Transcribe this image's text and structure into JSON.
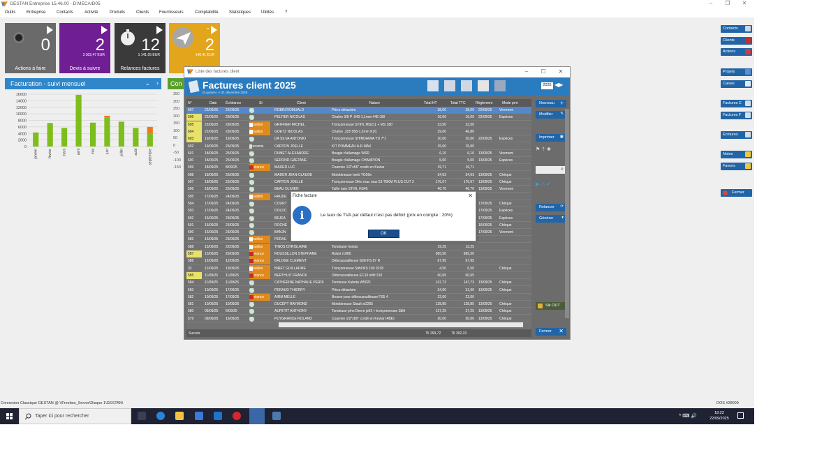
{
  "app": {
    "title": "GESTAN Entreprise 15.46.00 - D:MECA/D05",
    "window_controls": [
      "–",
      "❐",
      "✕"
    ]
  },
  "menu": [
    "Outils",
    "Entreprise",
    "Contacts",
    "Activité",
    "Produits",
    "Clients",
    "Fournisseurs",
    "Comptabilité",
    "Statistiques",
    "Utilités",
    "?"
  ],
  "tiles": [
    {
      "big": "0",
      "sub": "",
      "label": "Actions à faire",
      "color": "#6a6a6a"
    },
    {
      "big": "2",
      "sub": "3 302,47 EUR",
      "label": "Devis à suivre",
      "color": "#6f1f93"
    },
    {
      "big": "12",
      "sub": "1 141,05 EUR",
      "label": "Relances factures",
      "color": "#3a3a3a"
    },
    {
      "big": "2",
      "sub": "140,41 EUR",
      "label": "À ...",
      "color": "#e2a51c"
    }
  ],
  "chart_panel": {
    "title": "Facturation - suivi mensuel",
    "second_title": "Con"
  },
  "chart_data": {
    "type": "bar",
    "categories": [
      "janvier",
      "février",
      "mars",
      "avril",
      "mai",
      "juin",
      "juillet",
      "août",
      "septembre"
    ],
    "series": [
      {
        "values": [
          4300,
          7200,
          5700,
          15800,
          7300,
          8900,
          7600,
          5700,
          4000
        ],
        "color": "#7dbd1c"
      },
      {
        "values": [
          0,
          0,
          0,
          0,
          0,
          500,
          0,
          0,
          2000
        ],
        "color": "#e87a1e"
      }
    ],
    "ylim": [
      0,
      16000
    ],
    "yticks": [
      0,
      2000,
      4000,
      6000,
      8000,
      10000,
      12000,
      14000,
      16000
    ],
    "grid": true,
    "second_axis_ticks": [
      "350",
      "300",
      "250",
      "200",
      "150",
      "100",
      "50",
      "0",
      "-50",
      "-100",
      "-150"
    ]
  },
  "sidebar": [
    {
      "label": "Contacts",
      "icon": "people-icon"
    },
    {
      "label": "Clients",
      "icon": "clients-icon"
    },
    {
      "label": "Actions",
      "icon": "actions-icon"
    },
    {
      "label": "Projets",
      "icon": "projects-icon"
    },
    {
      "label": "Caisse",
      "icon": "cash-icon"
    },
    {
      "label": "Factures C",
      "icon": "invoice-client-icon"
    },
    {
      "label": "Factures F",
      "icon": "invoice-supplier-icon"
    },
    {
      "label": "Écritures",
      "icon": "entries-icon"
    },
    {
      "label": "Notes",
      "icon": "notes-icon"
    },
    {
      "label": "Favoris",
      "icon": "star-icon"
    },
    {
      "label": "Fermer",
      "icon": "close-icon"
    }
  ],
  "status": {
    "left": "Connexion Classique GESTAN @ \\\\Freebox_Server\\Disque 1\\GESTAN\\",
    "right": "DOS #28009"
  },
  "taskbar": {
    "search_placeholder": "Taper ici pour rechercher",
    "time": "18:22",
    "date": "22/09/2025"
  },
  "invoice_window": {
    "title": "Liste des factures client",
    "banner_title": "Factures client 2025",
    "banner_sub": "Du janvier -> 31 décembre 2025",
    "year": "2025",
    "columns": [
      "N°",
      "Date",
      "Échéance",
      "St",
      "Client",
      "Nature",
      "Total HT",
      "Total TTC",
      "Règlement",
      "Mode pmt"
    ],
    "rows": [
      {
        "n": "607",
        "date": "22/09/25",
        "ech": "22/09/25",
        "st": "OK",
        "sti": "ok",
        "client": "ROBIN ROMUALD",
        "nature": "Pièce détachée",
        "ht": "38,00",
        "ttc": "38,00",
        "reg": "22/09/25",
        "mode": "Virement",
        "hl": "sel"
      },
      {
        "n": "606",
        "date": "22/09/25",
        "ech": "29/09/25",
        "st": "OK",
        "sti": "ok",
        "client": "PELTIER NICOLAS",
        "nature": "Chaîne 3/8 P .043-1,1mm 44E-3/8",
        "ht": "16,00",
        "ttc": "16,00",
        "reg": "22/09/25",
        "mode": "Espèces",
        "hl": "y"
      },
      {
        "n": "605",
        "date": "22/09/25",
        "ech": "29/09/25",
        "st": "Brouillon",
        "sti": "br",
        "client": "GRIFFIER MICHEL",
        "nature": "Tronçonneuse STIHL MS211 + MS 180",
        "ht": "23,50",
        "ttc": "23,50",
        "reg": "",
        "mode": "",
        "hl": "y"
      },
      {
        "n": "604",
        "date": "22/09/25",
        "ech": "29/09/25",
        "st": "Brouillon",
        "sti": "br",
        "client": "GOETZ NICOLAS",
        "nature": "Chaîne .325 058-1,5mm K2C",
        "ht": "39,00",
        "ttc": "46,80",
        "reg": "",
        "mode": "",
        "hl": "y"
      },
      {
        "n": "603",
        "date": "19/09/25",
        "ech": "19/09/25",
        "st": "OK",
        "sti": "ok",
        "client": "DA SILVA ANTONIO",
        "nature": "Tronçonneuse SHINDAIWA YD 7*1",
        "ht": "20,00",
        "ttc": "20,00",
        "reg": "22/09/25",
        "mode": "Espèces",
        "hl": "y"
      },
      {
        "n": "602",
        "date": "19/09/25",
        "ech": "26/09/25",
        "st": "Transmis",
        "sti": "tr",
        "client": "CARTON JOELLE",
        "nature": "KIT POMMEAU A.R MAX",
        "ht": "15,00",
        "ttc": "15,00",
        "reg": "",
        "mode": "",
        "hl": ""
      },
      {
        "n": "601",
        "date": "18/09/25",
        "ech": "25/09/25",
        "st": "OK",
        "sti": "ok",
        "client": "DUMET ALEXANDRE",
        "nature": "Bougie d'allumage WSR",
        "ht": "6,10",
        "ttc": "6,10",
        "reg": "13/09/25",
        "mode": "Virement",
        "hl": ""
      },
      {
        "n": "600",
        "date": "18/09/25",
        "ech": "25/09/25",
        "st": "OK",
        "sti": "ok",
        "client": "SEROND GAETANE",
        "nature": "Bougie d'allumage CHAMPION",
        "ht": "5,00",
        "ttc": "5,00",
        "reg": "13/09/25",
        "mode": "Espèces",
        "hl": ""
      },
      {
        "n": "599",
        "date": "18/09/25",
        "ech": "8/09/25",
        "st": "À relance",
        "sti": "rel",
        "client": "MADER LUC",
        "nature": "Courroie 1/2\"x56\" cordé en Kevlar",
        "ht": "19,71",
        "ttc": "19,71",
        "reg": "",
        "mode": "",
        "hl": ""
      },
      {
        "n": "598",
        "date": "18/09/25",
        "ech": "25/09/25",
        "st": "OK",
        "sti": "ok",
        "client": "MADER JEAN-CLAUDE",
        "nature": "Motobineuse Iseki YG50e",
        "ht": "34,63",
        "ttc": "34,63",
        "reg": "13/09/25",
        "mode": "Chèque",
        "hl": ""
      },
      {
        "n": "597",
        "date": "18/09/25",
        "ech": "25/09/25",
        "st": "OK",
        "sti": "ok",
        "client": "CARTON JOELLE",
        "nature": "Tronçonneuse Oléo mac max 53 TBKM PLUS CUT 2",
        "ht": "176,67",
        "ttc": "176,67",
        "reg": "13/09/25",
        "mode": "Chèque",
        "hl": ""
      },
      {
        "n": "596",
        "date": "18/09/25",
        "ech": "25/09/25",
        "st": "OK",
        "sti": "ok",
        "client": "BEAU OLIVIER",
        "nature": "Taille haie STIHL HS45",
        "ht": "46,70",
        "ttc": "46,70",
        "reg": "13/09/25",
        "mode": "Virement",
        "hl": ""
      },
      {
        "n": "595",
        "date": "17/09/25",
        "ech": "24/09/25",
        "st": "Brouillon",
        "sti": "br",
        "client": "RAUDE",
        "nature": "",
        "ht": "",
        "ttc": "",
        "reg": "",
        "mode": "",
        "hl": ""
      },
      {
        "n": "594",
        "date": "17/09/25",
        "ech": "24/09/25",
        "st": "OK",
        "sti": "ok",
        "client": "COURT",
        "nature": "",
        "ht": "",
        "ttc": "",
        "reg": "17/09/25",
        "mode": "Chèque",
        "hl": ""
      },
      {
        "n": "593",
        "date": "17/09/25",
        "ech": "24/09/25",
        "st": "OK",
        "sti": "ok",
        "client": "DOLDC",
        "nature": "",
        "ht": "",
        "ttc": "",
        "reg": "17/09/25",
        "mode": "Espèces",
        "hl": ""
      },
      {
        "n": "592",
        "date": "16/09/25",
        "ech": "23/09/25",
        "st": "OK",
        "sti": "ok",
        "client": "BEJEA",
        "nature": "",
        "ht": "",
        "ttc": "",
        "reg": "17/09/25",
        "mode": "Espèces",
        "hl": ""
      },
      {
        "n": "591",
        "date": "16/09/25",
        "ech": "23/09/25",
        "st": "OK",
        "sti": "ok",
        "client": "ROCHE",
        "nature": "",
        "ht": "",
        "ttc": "",
        "reg": "16/09/25",
        "mode": "Chèque",
        "hl": ""
      },
      {
        "n": "590",
        "date": "16/09/25",
        "ech": "23/09/25",
        "st": "OK",
        "sti": "ok",
        "client": "BANJN",
        "nature": "",
        "ht": "",
        "ttc": "",
        "reg": "17/09/25",
        "mode": "Virement",
        "hl": ""
      },
      {
        "n": "589",
        "date": "16/09/25",
        "ech": "23/09/25",
        "st": "Brouillon",
        "sti": "br",
        "client": "PERAU",
        "nature": "",
        "ht": "",
        "ttc": "",
        "reg": "",
        "mode": "",
        "hl": ""
      },
      {
        "n": "588",
        "date": "15/09/25",
        "ech": "22/09/25",
        "st": "Brouillon",
        "sti": "br",
        "client": "TINOS CHRISLAINE",
        "nature": "Tondeuse honda",
        "ht": "19,25",
        "ttc": "13,25",
        "reg": "",
        "mode": "",
        "hl": ""
      },
      {
        "n": "587",
        "date": "13/09/25",
        "ech": "20/09/25",
        "st": "À relance",
        "sti": "rel",
        "client": "ROUSSILLON STEPHANE",
        "nature": "Robot r1080",
        "ht": "965,50",
        "ttc": "965,50",
        "reg": "",
        "mode": "",
        "hl": "y"
      },
      {
        "n": "586",
        "date": "12/09/25",
        "ech": "12/09/25",
        "st": "À relance",
        "sti": "rel",
        "client": "BALOGE CLEMENT",
        "nature": "Débroussailleuse Stihl FS 87 R",
        "ht": "67,95",
        "ttc": "67,95",
        "reg": "",
        "mode": "",
        "hl": ""
      },
      {
        "n": "32",
        "date": "12/09/25",
        "ech": "19/09/25",
        "st": "Brouillon",
        "sti": "br",
        "client": "BIRET GUILLAUME",
        "nature": "Tronçonneuse Stihl MS 180 2018",
        "ht": "4,50",
        "ttc": "6,50",
        "reg": "",
        "mode": "Chèque",
        "hl": ""
      },
      {
        "n": "585",
        "date": "11/09/25",
        "ech": "11/09/25",
        "st": "À relance",
        "sti": "rel",
        "client": "BERTHUIT FRANCK",
        "nature": "Débroussailleuse EC10 stihl 310",
        "ht": "60,65",
        "ttc": "60,65",
        "reg": "",
        "mode": "",
        "hl": "y"
      },
      {
        "n": "584",
        "date": "11/09/25",
        "ech": "11/09/25",
        "st": "OK",
        "sti": "ok",
        "client": "CATHERINE NATHALIE PERDI",
        "nature": "Tondeuse Kubota W5021",
        "ht": "147,73",
        "ttc": "147,73",
        "reg": "13/09/25",
        "mode": "Chèque",
        "hl": ""
      },
      {
        "n": "583",
        "date": "10/09/25",
        "ech": "17/09/25",
        "st": "OK",
        "sti": "ok",
        "client": "PERAUD THIERRY",
        "nature": "Pièce détachée",
        "ht": "34,60",
        "ttc": "31,60",
        "reg": "13/09/25",
        "mode": "Chèque",
        "hl": ""
      },
      {
        "n": "582",
        "date": "10/09/25",
        "ech": "17/09/25",
        "st": "À relance",
        "sti": "rel",
        "client": "AIRM MELLE",
        "nature": "Brosse pour débroussailleuse FS5 4",
        "ht": "22,00",
        "ttc": "22,00",
        "reg": "",
        "mode": "",
        "hl": ""
      },
      {
        "n": "581",
        "date": "10/09/25",
        "ech": "10/09/25",
        "st": "OK",
        "sti": "ok",
        "client": "DUCEPT RAYMOND",
        "nature": "Motobineuse Stault st2265",
        "ht": "128,85",
        "ttc": "128,85",
        "reg": "13/09/25",
        "mode": "Chèque",
        "hl": ""
      },
      {
        "n": "580",
        "date": "09/09/25",
        "ech": "6/09/25",
        "st": "OK",
        "sti": "ok",
        "client": "AUPETIT ANTHONY",
        "nature": "Tondeuse john Deere js63 + tronçonneuse Stihl",
        "ht": "137,25",
        "ttc": "37,25",
        "reg": "13/09/25",
        "mode": "Chèque",
        "hl": ""
      },
      {
        "n": "579",
        "date": "09/09/25",
        "ech": "16/09/25",
        "st": "OK",
        "sti": "ok",
        "client": "PUYGRANCE ROLAND",
        "nature": "Courroie 1/2\"x80\" cordé en Kevlar (4BE)",
        "ht": "30,00",
        "ttc": "30,00",
        "reg": "13/09/25",
        "mode": "Chèque",
        "hl": ""
      }
    ],
    "footer_label": "Succès",
    "total_ht": "75 293,72",
    "total_ttc": "76 302,33",
    "buttons": [
      "Nouveau",
      "Modifier",
      "Imprimer",
      "Relancer",
      "Générer",
      "Fermer",
      "Sik OUT"
    ]
  },
  "dialog": {
    "title": "Fiche facture",
    "message": "Le taux de TVA par défaut n'est pas défini! (prix en compte : 20%)",
    "ok": "OK"
  }
}
